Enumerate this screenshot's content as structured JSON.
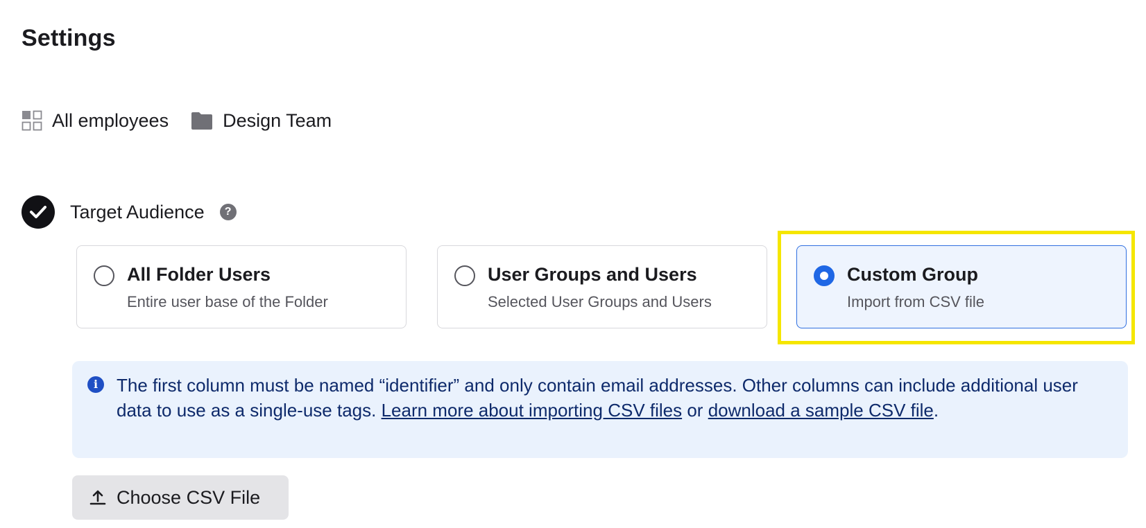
{
  "page": {
    "title": "Settings"
  },
  "breadcrumb": {
    "items": [
      {
        "label": "All employees",
        "icon": "grid-icon"
      },
      {
        "label": "Design Team",
        "icon": "folder-icon"
      }
    ]
  },
  "target_audience": {
    "label": "Target Audience",
    "help_icon": "question-circle-icon",
    "help_glyph": "?",
    "status_icon": "check-circle-icon",
    "options": [
      {
        "title": "All Folder Users",
        "description": "Entire user base of the Folder",
        "selected": false
      },
      {
        "title": "User Groups and Users",
        "description": "Selected User Groups and Users",
        "selected": false
      },
      {
        "title": "Custom Group",
        "description": "Import from CSV file",
        "selected": true
      }
    ]
  },
  "info": {
    "icon": "info-icon",
    "glyph": "i",
    "text_before": "The first column must be named “identifier” and only contain email addresses. Other columns can include additional user data to use as a single-use tags. ",
    "link1": "Learn more about importing CSV files",
    "text_middle": " or ",
    "link2": "download a sample CSV file",
    "text_after": "."
  },
  "upload": {
    "label": "Choose CSV File",
    "icon": "upload-icon"
  },
  "colors": {
    "accent": "#1f67e5",
    "selected_bg": "#eef4fe",
    "info_bg": "#eaf2fd",
    "highlight": "#f5e600"
  }
}
